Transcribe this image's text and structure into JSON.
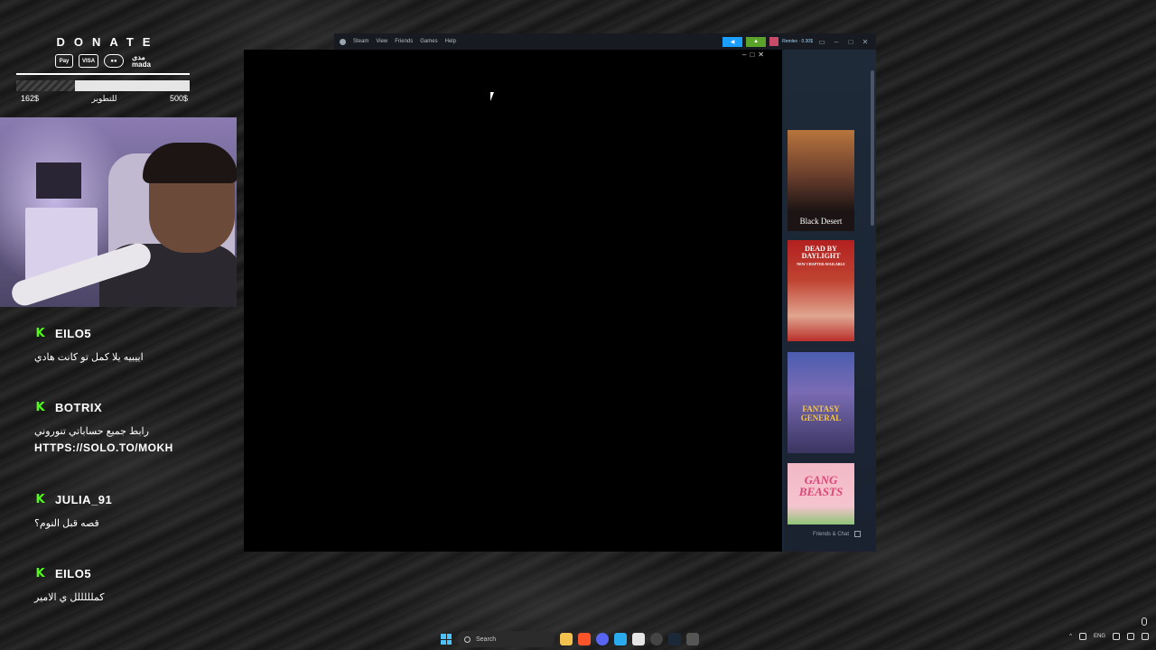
{
  "donate": {
    "title": "DONATE",
    "payment_methods": [
      "Pay",
      "VISA",
      "mastercard",
      "مدى",
      "mada"
    ],
    "goal_current": "162$",
    "goal_label": "للتطوير",
    "goal_target": "500$"
  },
  "chat": {
    "messages": [
      {
        "user": "EILO5",
        "text": "اييبيه يلا كمل تو كانت هادي"
      },
      {
        "user": "BOTRIX",
        "text": "رابط جميع حساباتي تنوروني",
        "link": "HTTPS://SOLO.TO/MOKH"
      },
      {
        "user": "JULIA_91",
        "text": "قصه قبل النوم؟"
      },
      {
        "user": "EILO5",
        "text": "كملللللل ي الامير"
      }
    ]
  },
  "steam": {
    "menu": [
      "Steam",
      "View",
      "Friends",
      "Games",
      "Help"
    ],
    "username": "Remlex · 0.30$",
    "store_covers": [
      {
        "title": "Black Desert"
      },
      {
        "title": "DEAD BY DAYLIGHT",
        "subtitle": "NEW CHAPTER AVAILABLE"
      },
      {
        "title": "FANTASY GENERAL"
      },
      {
        "title": "GANG BEASTS"
      }
    ],
    "friends_chat": "Friends & Chat"
  },
  "taskbar": {
    "search_placeholder": "Search",
    "language": "ENG"
  },
  "colors": {
    "kick_green": "#53fc18",
    "steam_dark": "#171a21",
    "steam_blue": "#1a9fff",
    "steam_green": "#5ba32b"
  }
}
